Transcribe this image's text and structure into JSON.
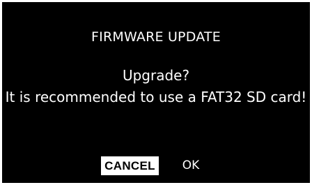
{
  "dialog": {
    "title": "FIRMWARE UPDATE",
    "question": "Upgrade?",
    "message": "It is recommended to use a FAT32 SD card!",
    "cancel_label": "CANCEL",
    "ok_label": "OK",
    "selected_button": "CANCEL"
  },
  "colors": {
    "background": "#000000",
    "text": "#ffffff",
    "selected_button_bg": "#ffffff",
    "selected_button_text": "#000000"
  }
}
